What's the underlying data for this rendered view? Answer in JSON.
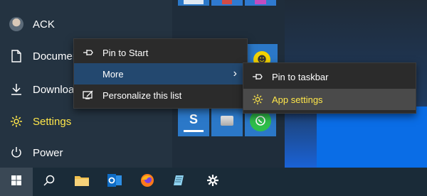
{
  "rail": {
    "user_name": "ACK",
    "documents": "Documer",
    "downloads": "Downloa",
    "settings": "Settings",
    "power": "Power"
  },
  "context_menu": {
    "pin_to_start": "Pin to Start",
    "more": "More",
    "personalize": "Personalize this list"
  },
  "submenu": {
    "pin_to_taskbar": "Pin to taskbar",
    "app_settings": "App settings"
  },
  "colors": {
    "highlight_yellow": "#ffe74a",
    "menu_bg": "#2b2b2b",
    "more_highlight": "#23486f",
    "tile_blue": "#2b78c8"
  },
  "taskbar": {
    "icons": [
      "windows-logo-icon",
      "search-icon",
      "file-explorer-icon",
      "outlook-icon",
      "firefox-icon",
      "notepad-icon",
      "settings-gear-icon"
    ]
  }
}
